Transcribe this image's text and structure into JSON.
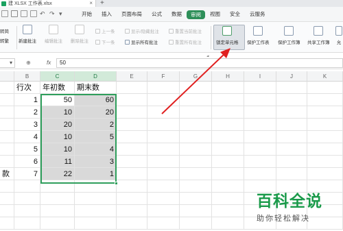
{
  "titlebar": {
    "doc_tab_label": "建 XLSX 工作表.xlsx",
    "close_glyph": "×",
    "new_tab_glyph": "+"
  },
  "menubar": {
    "items": [
      "开始",
      "插入",
      "页面布局",
      "公式",
      "数据",
      "审阅",
      "视图",
      "安全",
      "云服务"
    ],
    "active_item": "审阅"
  },
  "ribbon": {
    "left_labels": [
      "转简",
      "转繁"
    ],
    "new_comment": "新建批注",
    "edit_comment": "编辑批注",
    "delete_comment": "删除批注",
    "prev_item": "上一条",
    "next_item": "下一条",
    "show_hide_comment": "显示/隐藏批注",
    "show_all_comments": "显示所有批注",
    "reset_current_comment": "重置当前批注",
    "reset_all_comments": "重置所有批注",
    "lock_cell": "锁定单元格",
    "protect_sheet": "保护工作表",
    "protect_workbook": "保护工作簿",
    "share_workbook": "共享工作簿",
    "allow_edit": "允"
  },
  "formulabar": {
    "fx_label": "fx",
    "value": "50"
  },
  "columns": [
    "B",
    "C",
    "D",
    "E",
    "F",
    "G",
    "H",
    "I",
    "J",
    "K"
  ],
  "table": {
    "headers": {
      "b": "行次",
      "c": "年初数",
      "d": "期末数"
    },
    "rows": [
      {
        "a": "",
        "b": "1",
        "c": "50",
        "d": "60"
      },
      {
        "a": "",
        "b": "2",
        "c": "10",
        "d": "20"
      },
      {
        "a": "",
        "b": "3",
        "c": "20",
        "d": "2"
      },
      {
        "a": "",
        "b": "4",
        "c": "10",
        "d": "5"
      },
      {
        "a": "",
        "b": "5",
        "c": "10",
        "d": "4"
      },
      {
        "a": "",
        "b": "6",
        "c": "11",
        "d": "3"
      },
      {
        "a": "款",
        "b": "7",
        "c": "22",
        "d": "1"
      }
    ]
  },
  "watermark": {
    "title": "百科全说",
    "subtitle": "助你轻松解决"
  },
  "colors": {
    "accent_green": "#2e8f59",
    "selection_border": "#2e9e5b",
    "annotation_arrow": "#e02020",
    "watermark_green": "#1a9a4a"
  }
}
